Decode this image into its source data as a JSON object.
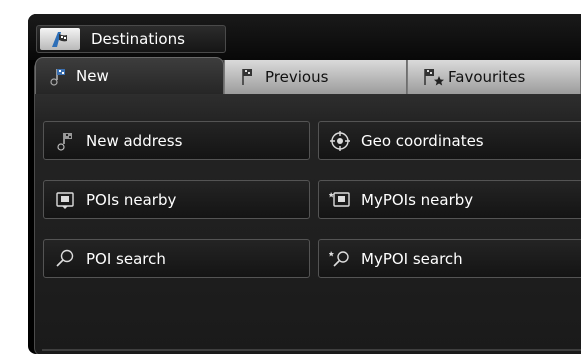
{
  "header": {
    "title": "Destinations",
    "icon": "destination-icon"
  },
  "tabs": [
    {
      "label": "New",
      "icon": "flag-icon",
      "active": true
    },
    {
      "label": "Previous",
      "icon": "flag-icon",
      "active": false
    },
    {
      "label": "Favourites",
      "icon": "favourite-flag-icon",
      "active": false
    }
  ],
  "buttons": {
    "new_address": "New address",
    "geo_coordinates": "Geo coordinates",
    "pois_nearby": "POIs nearby",
    "mypois_nearby": "MyPOIs nearby",
    "poi_search": "POI search",
    "mypoi_search": "MyPOI search"
  },
  "colors": {
    "background": "#000000",
    "text": "#ffffff",
    "tab_inactive": "#c8c8c8"
  }
}
